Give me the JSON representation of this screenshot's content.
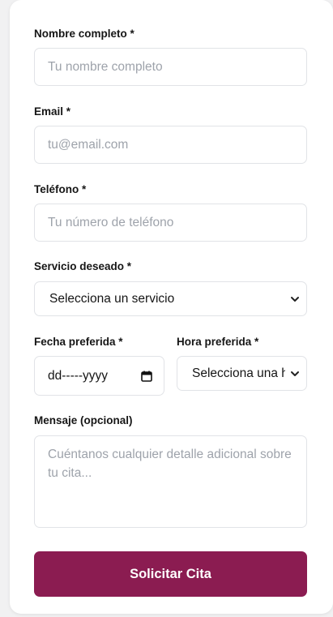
{
  "form": {
    "name": {
      "label": "Nombre completo *",
      "placeholder": "Tu nombre completo"
    },
    "email": {
      "label": "Email *",
      "placeholder": "tu@email.com"
    },
    "phone": {
      "label": "Teléfono *",
      "placeholder": "Tu número de teléfono"
    },
    "service": {
      "label": "Servicio deseado *",
      "selected": "Selecciona un servicio"
    },
    "date": {
      "label": "Fecha preferida *",
      "value": "dd-----yyyy"
    },
    "time": {
      "label": "Hora preferida *",
      "selected": "Selecciona una hora"
    },
    "message": {
      "label": "Mensaje (opcional)",
      "placeholder": "Cuéntanos cualquier detalle adicional sobre tu cita..."
    },
    "submit_label": "Solicitar Cita"
  },
  "icons": {
    "select_arrow": "chevron-down-icon",
    "calendar": "calendar-icon"
  },
  "colors": {
    "accent": "#8b1c51",
    "border": "#e1e3e7",
    "placeholder": "#9ea3ab"
  }
}
